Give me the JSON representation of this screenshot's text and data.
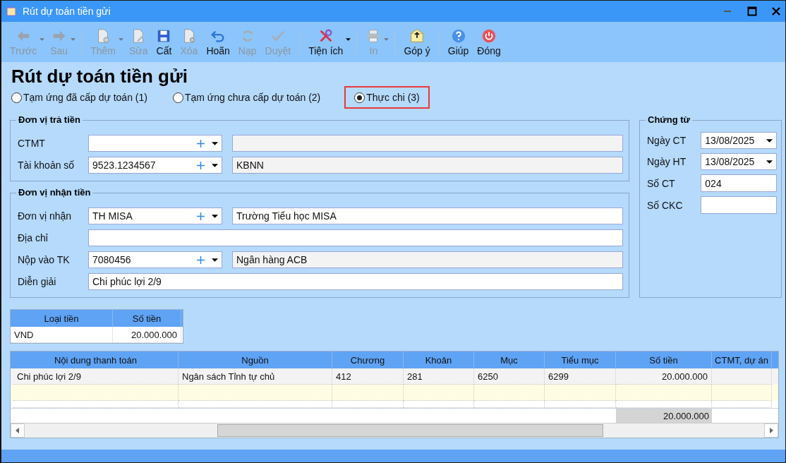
{
  "window": {
    "title": "Rút dự toán tiền gửi"
  },
  "toolbar": {
    "groups": [
      [
        {
          "label": "Trước",
          "disabled": true,
          "dropdown": true
        },
        {
          "label": "Sau",
          "disabled": true,
          "dropdown": true
        }
      ],
      [
        {
          "label": "Thêm",
          "disabled": true,
          "dropdown": true
        },
        {
          "label": "Sửa",
          "disabled": true,
          "dropdown": false
        },
        {
          "label": "Cất",
          "disabled": false,
          "dropdown": false
        },
        {
          "label": "Xóa",
          "disabled": true,
          "dropdown": false
        },
        {
          "label": "Hoãn",
          "disabled": false,
          "dropdown": false
        },
        {
          "label": "Nạp",
          "disabled": true,
          "dropdown": false
        },
        {
          "label": "Duyệt",
          "disabled": true,
          "dropdown": false
        }
      ],
      [
        {
          "label": "Tiện ích",
          "disabled": false,
          "dropdown": true
        }
      ],
      [
        {
          "label": "In",
          "disabled": true,
          "dropdown": true
        }
      ],
      [
        {
          "label": "Góp ý",
          "disabled": false,
          "dropdown": false
        }
      ],
      [
        {
          "label": "Giúp",
          "disabled": false,
          "dropdown": false
        },
        {
          "label": "Đóng",
          "disabled": false,
          "dropdown": false
        }
      ]
    ]
  },
  "heading": "Rút dự toán tiền gửi",
  "modes": [
    {
      "label": "Tạm ứng đã cấp dự toán (1)",
      "selected": false
    },
    {
      "label": "Tạm ứng chưa cấp dự toán (2)",
      "selected": false
    },
    {
      "label": "Thực chi (3)",
      "selected": true
    }
  ],
  "sections": [
    {
      "title": "Đơn vị trả tiền",
      "rows": [
        {
          "label": "CTMT",
          "kind": "lookup",
          "value": "",
          "name": ""
        },
        {
          "label": "Tài khoản số",
          "kind": "lookup",
          "value": "9523.1234567",
          "name": "KBNN"
        }
      ]
    },
    {
      "title": "Đơn vị nhận tiền",
      "rows": [
        {
          "label": "Đơn vị nhận",
          "kind": "lookup",
          "value": "TH MISA",
          "name": "Trường Tiểu học MISA",
          "name_editable": true
        },
        {
          "label": "Địa chỉ",
          "kind": "text",
          "value": ""
        },
        {
          "label": "Nộp vào TK",
          "kind": "lookup",
          "value": "7080456",
          "name": "Ngân hàng ACB",
          "name_editable": false
        },
        {
          "label": "Diễn giải",
          "kind": "text",
          "value": "Chi phúc lợi 2/9"
        }
      ]
    }
  ],
  "voucher": {
    "title": "Chứng từ",
    "rows": [
      {
        "label": "Ngày CT",
        "kind": "date",
        "value": "13/08/2025"
      },
      {
        "label": "Ngày HT",
        "kind": "date",
        "value": "13/08/2025"
      },
      {
        "label": "Số CT",
        "kind": "text",
        "value": "024"
      },
      {
        "label": "Số CKC",
        "kind": "text",
        "value": ""
      }
    ]
  },
  "currency_table": {
    "columns": [
      "Loại tiền",
      "Số tiền"
    ],
    "rows": [
      [
        "VND",
        "20.000.000"
      ]
    ]
  },
  "table": {
    "columns": [
      "Nội dung thanh toán",
      "Nguồn",
      "Chương",
      "Khoản",
      "Mục",
      "Tiểu mục",
      "Số tiền",
      "CTMT, dự án"
    ],
    "rows": [
      [
        "Chi phúc lợi 2/9",
        "Ngân sách Tỉnh tự chủ",
        "412",
        "281",
        "6250",
        "6299",
        "20.000.000",
        ""
      ]
    ],
    "total": "20.000.000"
  }
}
